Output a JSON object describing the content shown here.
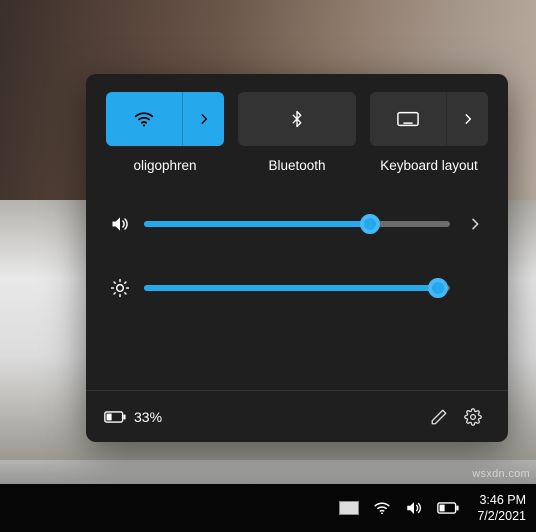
{
  "accent": "#26a8ed",
  "tiles": {
    "wifi": {
      "label": "oligophren",
      "active": true
    },
    "bt": {
      "label": "Bluetooth",
      "active": false
    },
    "kb": {
      "label": "Keyboard layout",
      "active": false
    }
  },
  "sliders": {
    "volume": {
      "value": 74
    },
    "brightness": {
      "value": 96
    }
  },
  "battery": {
    "percent_label": "33%"
  },
  "taskbar": {
    "time": "3:46 PM",
    "date": "7/2/2021"
  },
  "watermark": "wsxdn.com"
}
